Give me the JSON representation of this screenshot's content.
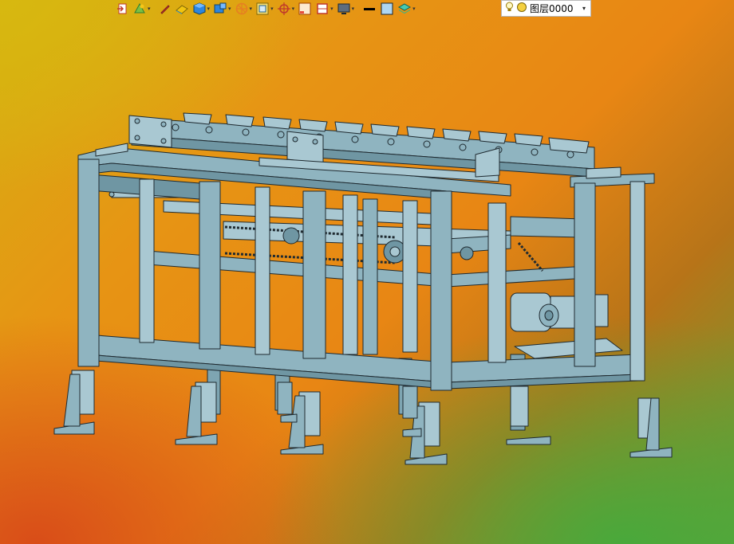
{
  "toolbar": {
    "layer_label": "图层0000",
    "layer_dropdown_caret": "▾",
    "caret": "▾",
    "buttons": [
      {
        "icon": "exit-icon"
      },
      {
        "icon": "render-mode-icon"
      },
      {
        "icon": "pen-icon"
      },
      {
        "icon": "eraser-icon"
      },
      {
        "icon": "cube-icon"
      },
      {
        "icon": "view-orientation-icon"
      },
      {
        "icon": "wheel-icon"
      },
      {
        "icon": "zoom-fit-icon"
      },
      {
        "icon": "crosshair-icon"
      },
      {
        "icon": "frame-icon"
      },
      {
        "icon": "section-icon"
      },
      {
        "icon": "display-icon"
      },
      {
        "icon": "line-color-icon"
      },
      {
        "icon": "fill-color-icon"
      },
      {
        "icon": "layers-icon"
      }
    ]
  },
  "colors": {
    "model_fill": "#8fb4c0",
    "model_shade": "#6f96a3",
    "model_light": "#a9c8d2",
    "line": "#1f2a30",
    "bg_yellow": "#d6b012",
    "bg_orange": "#e88614",
    "bg_green": "#65a338"
  }
}
